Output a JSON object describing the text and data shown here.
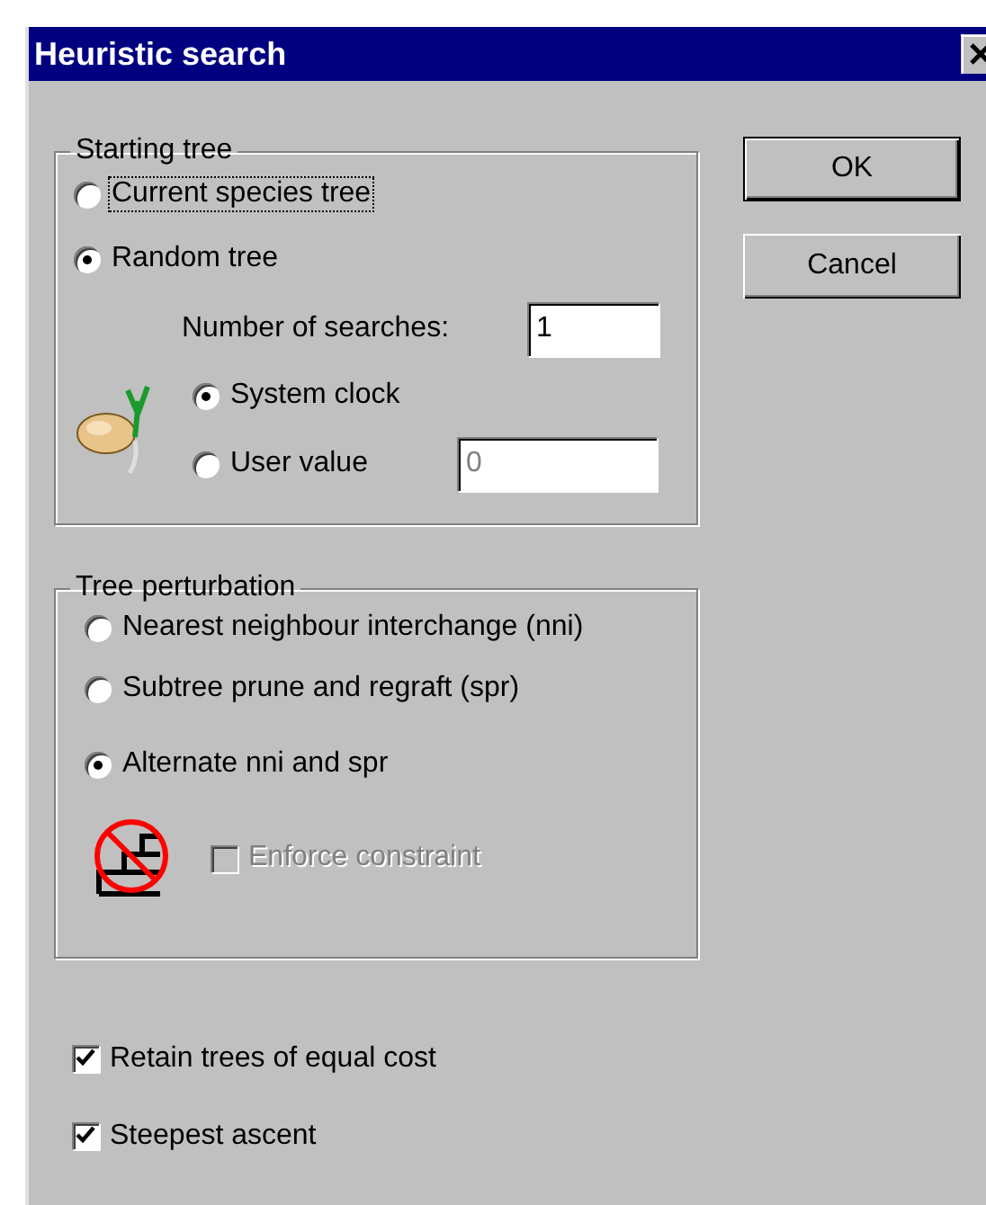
{
  "window": {
    "title": "Heuristic search"
  },
  "starting_tree": {
    "title": "Starting tree",
    "options": [
      {
        "label": "Current species tree",
        "selected": false,
        "focused": true
      },
      {
        "label": "Random tree",
        "selected": true,
        "focused": false
      }
    ],
    "number_of_searches": {
      "label": "Number of searches:",
      "value": "1"
    },
    "seed_options": [
      {
        "label": "System clock",
        "selected": true
      },
      {
        "label": "User value",
        "selected": false
      }
    ],
    "user_value": {
      "value": "0",
      "disabled": true
    }
  },
  "buttons": [
    {
      "label": "OK",
      "default": true
    },
    {
      "label": "Cancel",
      "default": false
    }
  ],
  "tree_perturbation": {
    "title": "Tree perturbation",
    "options": [
      {
        "label": "Nearest neighbour interchange (nni)",
        "selected": false
      },
      {
        "label": "Subtree prune and regraft (spr)",
        "selected": false
      },
      {
        "label": "Alternate nni and spr",
        "selected": true
      }
    ],
    "enforce_constraint": {
      "label": "Enforce constraint",
      "checked": false,
      "disabled": true
    }
  },
  "checkboxes": [
    {
      "label": "Retain trees of equal cost",
      "checked": true
    },
    {
      "label": "Steepest ascent",
      "checked": true
    }
  ]
}
